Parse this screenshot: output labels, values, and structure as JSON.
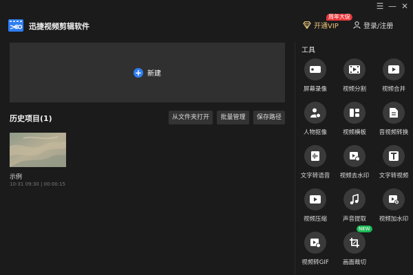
{
  "app": {
    "title": "迅捷视频剪辑软件"
  },
  "window": {
    "menu": "☰",
    "minimize": "—",
    "close": "✕"
  },
  "header": {
    "vip_label": "开通VIP",
    "vip_badge": "周年大促",
    "login_label": "登录/注册"
  },
  "main": {
    "new_label": "新建",
    "history_title": "历史项目(1)",
    "buttons": {
      "open_folder": "从文件夹打开",
      "batch_manage": "批量管理",
      "save_path": "保存路径"
    },
    "projects": [
      {
        "name": "示例",
        "meta": "10-31 09:30 | 00:00:15"
      }
    ]
  },
  "tools": {
    "title": "工具",
    "items": [
      {
        "label": "屏幕录像",
        "icon": "screen-record-icon"
      },
      {
        "label": "视频分割",
        "icon": "video-split-icon"
      },
      {
        "label": "视频合并",
        "icon": "video-merge-icon"
      },
      {
        "label": "人物抠像",
        "icon": "portrait-cutout-icon"
      },
      {
        "label": "视频横板",
        "icon": "video-landscape-icon"
      },
      {
        "label": "音视频转换",
        "icon": "av-convert-icon"
      },
      {
        "label": "文字转语音",
        "icon": "text-to-speech-icon"
      },
      {
        "label": "视频去水印",
        "icon": "remove-watermark-icon"
      },
      {
        "label": "文字转视频",
        "icon": "text-to-video-icon"
      },
      {
        "label": "视频压缩",
        "icon": "video-compress-icon"
      },
      {
        "label": "声音提取",
        "icon": "audio-extract-icon"
      },
      {
        "label": "视频加水印",
        "icon": "add-watermark-icon"
      },
      {
        "label": "视频转GIF",
        "icon": "video-to-gif-icon"
      },
      {
        "label": "画面裁切",
        "icon": "crop-icon",
        "badge": "NEW"
      }
    ]
  },
  "colors": {
    "background": "#1b1b1b",
    "panel": "#303030",
    "accent": "#2f7ef2",
    "vip": "#e8c27a",
    "badge_red": "#e8373b",
    "badge_green": "#1db954"
  }
}
